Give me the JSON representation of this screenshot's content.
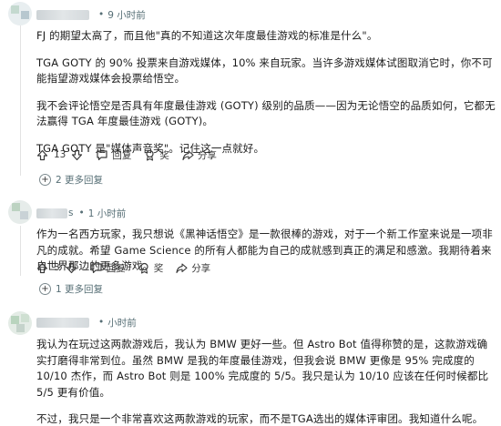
{
  "comments": [
    {
      "time": "9 小时前",
      "paragraphs": [
        "FJ 的期望太高了，而且他\"真的不知道这次年度最佳游戏的标准是什么\"。",
        "TGA GOTY 的 90% 投票来自游戏媒体，10% 来自玩家。当许多游戏媒体试图取消它时，你不可能指望游戏媒体会投票给悟空。",
        "我不会评论悟空是否具有年度最佳游戏 (GOTY) 级别的品质——因为无论悟空的品质如何，它都无法赢得 TGA 年度最佳游戏 (GOTY)。",
        "TGA GOTY 是\"媒体声音奖\"。记住这一点就好。"
      ],
      "score": "13",
      "reply": "回复",
      "award": "奖",
      "share": "分享",
      "more": "2 更多回复"
    },
    {
      "username_suffix": "s",
      "time": "1 小时前",
      "paragraphs": [
        "作为一名西方玩家，我只想说《黑神话悟空》是一款很棒的游戏，对于一个新工作室来说是一项非凡的成就。希望 Game Science 的所有人都能为自己的成就感到真正的满足和感激。我期待着来自世界那边的更多游戏。"
      ],
      "score": "3",
      "reply": "回复",
      "award": "奖",
      "share": "分享",
      "more": "1 更多回复"
    },
    {
      "time": "小时前",
      "paragraphs": [
        "我认为在玩过这两款游戏后，我认为 BMW 更好一些。但 Astro Bot 值得称赞的是，这款游戏确实打磨得非常到位。虽然 BMW 是我的年度最佳游戏，但我会说 BMW 更像是 95% 完成度的 10/10 杰作，而 Astro Bot 则是 100% 完成度的 5/5。我只是认为 10/10 应该在任何时候都比 5/5 更有价值。",
        "不过，我只是一个非常喜欢这两款游戏的玩家，而不是TGA选出的媒体评审团。我知道什么呢。"
      ]
    }
  ]
}
